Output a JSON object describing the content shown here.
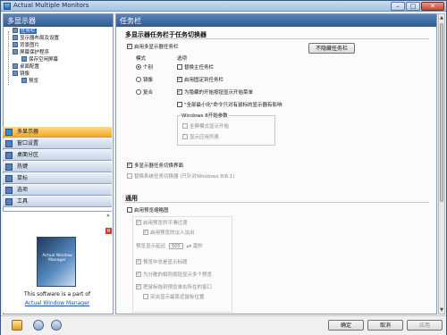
{
  "window": {
    "title": "Actual Multiple Monitors"
  },
  "left": {
    "header": "多显示器",
    "tree": [
      {
        "label": "任务栏",
        "selected": true
      },
      {
        "label": "显示器布局及设置"
      },
      {
        "label": "背景图片"
      },
      {
        "label": "屏幕保护程序"
      },
      {
        "label": "保存空闲屏幕"
      },
      {
        "label": "桌面配置"
      },
      {
        "label": "镜像"
      },
      {
        "label": "预览"
      }
    ],
    "nav": [
      {
        "label": "多显示器",
        "active": true
      },
      {
        "label": "窗口设置"
      },
      {
        "label": "桌面分区"
      },
      {
        "label": "热键"
      },
      {
        "label": "鼠标"
      },
      {
        "label": "选项"
      },
      {
        "label": "工具"
      }
    ],
    "promo": {
      "toggle": "»",
      "close": "✕",
      "box_title": "Actual Window Manager",
      "text": "This software is a part of",
      "link": "Actual Window Manager"
    }
  },
  "right": {
    "header": "任务栏",
    "section1_title": "多显示器任务栏于任务切换器",
    "enable_taskbar": {
      "label": "启用多显示器任务栏",
      "checked": true
    },
    "hide_button": "不隐藏任务栏",
    "mode_label": "模式",
    "options_label": "选项",
    "modes": [
      {
        "label": "个别",
        "checked": true
      },
      {
        "label": "镜像",
        "checked": false
      },
      {
        "label": "复合",
        "checked": false
      }
    ],
    "options": [
      {
        "label": "替换主任务栏",
        "checked": false
      },
      {
        "label": "启用固定到任务栏",
        "checked": true
      },
      {
        "label": "为隐藏的开始按钮显示开始菜单",
        "checked": true
      },
      {
        "label": "\"全部最小化\"命令只对有鼠标的显示器有影响",
        "checked": false
      }
    ],
    "win8_group": "Windows 8开始参数",
    "win8_options": [
      {
        "label": "全屏模式显示开始",
        "checked": false
      },
      {
        "label": "显示应用列表",
        "checked": false
      }
    ],
    "switcher_ui": {
      "label": "多显示器任务切换界面",
      "checked": true
    },
    "replace_switcher": {
      "label": "替换系统任务切换器 (只针对Windows 8/8.1)",
      "checked": false
    },
    "section2_title": "通用",
    "preview_enable": {
      "label": "启用预览缩略图",
      "checked": false
    },
    "preview_options": [
      {
        "label": "启用预览的平滑过渡",
        "checked": true
      },
      {
        "label": "启用预览的淡入淡出",
        "checked": true
      }
    ],
    "preview_delay_label": "预览显示延迟",
    "preview_delay_value": "500",
    "preview_delay_unit": "毫秒",
    "more_options": [
      {
        "label": "预览中总是显示标题",
        "checked": true
      },
      {
        "label": "为分散的相同按钮显示多个预览",
        "checked": true
      },
      {
        "label": "把鼠标拖到预览单击所在的窗口",
        "checked": true
      },
      {
        "label": "突出显示最靠近鼠标位置",
        "checked": false
      }
    ]
  },
  "buttons": {
    "ok": "确定",
    "cancel": "取消",
    "apply": "应用"
  },
  "colors": {
    "accent": "#2e5a94",
    "active_nav": "#f4a826"
  }
}
